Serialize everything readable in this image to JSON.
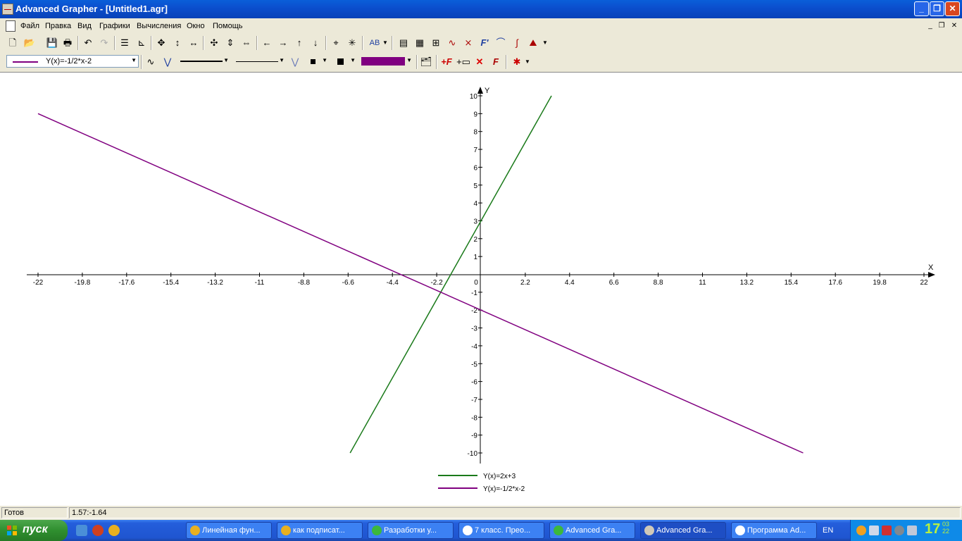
{
  "window": {
    "title": "Advanced Grapher - [Untitled1.agr]"
  },
  "menu": [
    "Файл",
    "Правка",
    "Вид",
    "Графики",
    "Вычисления",
    "Окно",
    "Помощь"
  ],
  "toolbar2": {
    "graph_select": "Y(x)=-1/2*x-2",
    "color": "#800080"
  },
  "chart_data": {
    "type": "line",
    "xlabel": "X",
    "ylabel": "Y",
    "xlim": [
      -22,
      22
    ],
    "ylim": [
      -10,
      10
    ],
    "x_ticks": [
      "-22",
      "-19.8",
      "-17.6",
      "-15.4",
      "-13.2",
      "-11",
      "-8.8",
      "-6.6",
      "-4.4",
      "-2.2",
      "0",
      "2.2",
      "4.4",
      "6.6",
      "8.8",
      "11",
      "13.2",
      "15.4",
      "17.6",
      "19.8",
      "22"
    ],
    "y_ticks": [
      "10",
      "9",
      "8",
      "7",
      "6",
      "5",
      "4",
      "3",
      "2",
      "1",
      "-1",
      "-2",
      "-3",
      "-4",
      "-5",
      "-6",
      "-7",
      "-8",
      "-9",
      "-10"
    ],
    "series": [
      {
        "name": "Y(x)=2x+3",
        "color": "#1a7a1a",
        "x": [
          -6.5,
          3.5
        ],
        "y": [
          -10,
          10
        ]
      },
      {
        "name": "Y(x)=-1/2*x-2",
        "color": "#800080",
        "x": [
          -22,
          16
        ],
        "y": [
          9,
          -10
        ]
      }
    ],
    "legend": "bottom-center",
    "grid": false
  },
  "status": {
    "state": "Готов",
    "coords": "1.57:-1.64"
  },
  "taskbar": {
    "start": "пуск",
    "tasks": [
      {
        "label": "Линейная фун...",
        "icon": "chrome-icon",
        "color": "#e8b020"
      },
      {
        "label": "как подписат...",
        "icon": "chrome-icon",
        "color": "#e8b020"
      },
      {
        "label": "Разработки у...",
        "icon": "green-cube-icon",
        "color": "#3cb83c"
      },
      {
        "label": "7 класс. Прео...",
        "icon": "word-icon",
        "color": "#ffffff"
      },
      {
        "label": "Advanced Gra...",
        "icon": "green-cube-icon",
        "color": "#3cb83c"
      },
      {
        "label": "Advanced Gra...",
        "icon": "grapher-icon",
        "color": "#d0c8b8",
        "active": true
      },
      {
        "label": "Программа Ad...",
        "icon": "word-icon",
        "color": "#ffffff"
      }
    ],
    "lang": "EN",
    "clock_hour": "17",
    "clock_min_a": "03",
    "clock_min_b": "22"
  }
}
